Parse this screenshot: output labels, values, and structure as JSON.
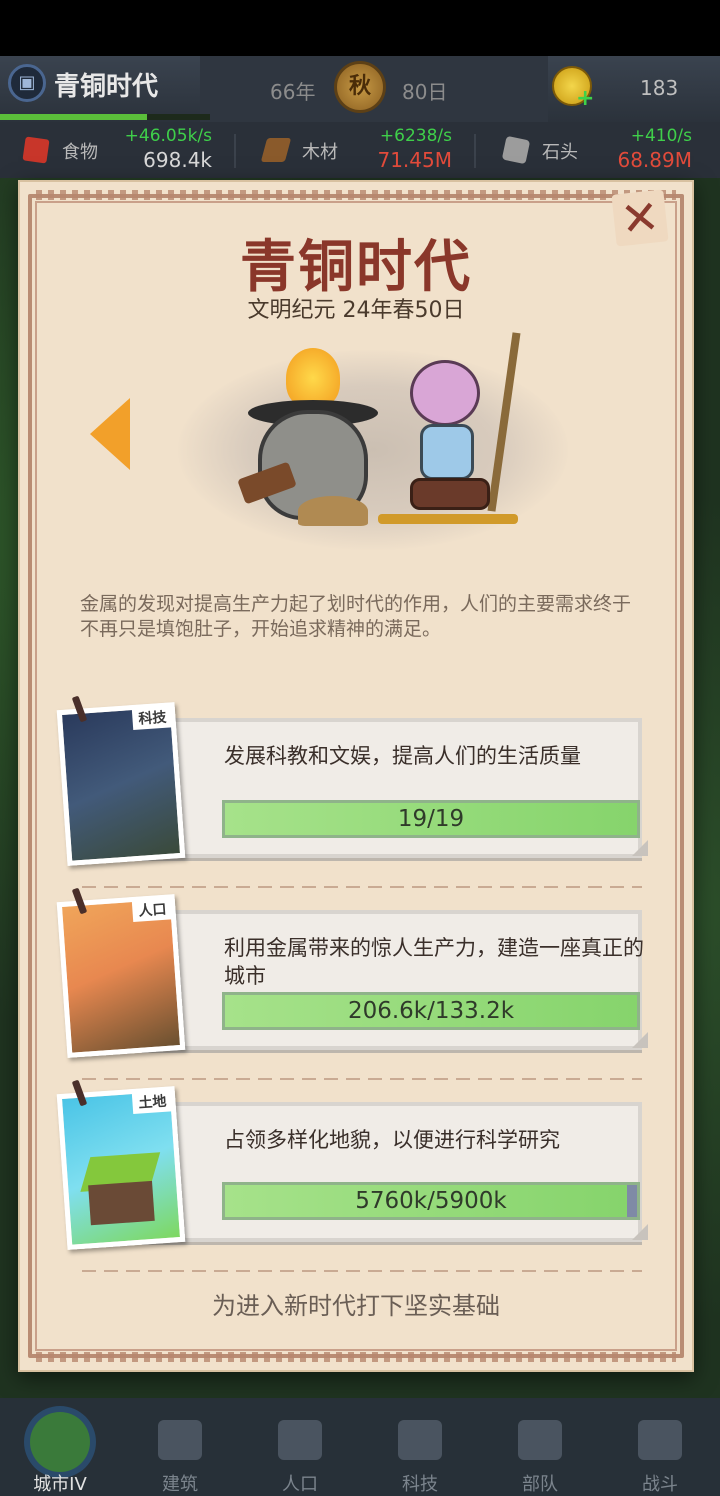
{
  "topbar": {
    "era_title": "青铜时代",
    "year": "66年",
    "season": "秋",
    "day": "80日",
    "coins": "183"
  },
  "resources": [
    {
      "name": "食物",
      "rate": "+46.05k/s",
      "amount": "698.4k"
    },
    {
      "name": "木材",
      "rate": "+6238/s",
      "amount": "71.45M"
    },
    {
      "name": "石头",
      "rate": "+410/s",
      "amount": "68.89M"
    }
  ],
  "dialog": {
    "title": "青铜时代",
    "date": "文明纪元 24年春50日",
    "description": "金属的发现对提高生产力起了划时代的作用，人们的主要需求终于不再只是填饱肚子，开始追求精神的满足。",
    "goals": [
      {
        "tag": "科技",
        "text": "发展科教和文娱，提高人们的生活质量",
        "progress": "19/19",
        "fraction": 1.0
      },
      {
        "tag": "人口",
        "text": "利用金属带来的惊人生产力，建造一座真正的城市",
        "progress": "206.6k/133.2k",
        "fraction": 1.0
      },
      {
        "tag": "土地",
        "text": "占领多样化地貌，以便进行科学研究",
        "progress": "5760k/5900k",
        "fraction": 0.976
      }
    ],
    "footer": "为进入新时代打下坚实基础"
  },
  "nav": [
    {
      "label": "城市IV"
    },
    {
      "label": "建筑"
    },
    {
      "label": "人口"
    },
    {
      "label": "科技"
    },
    {
      "label": "部队"
    },
    {
      "label": "战斗"
    }
  ],
  "colors": {
    "accent_title": "#8a372a",
    "progress_green": "#86d46c",
    "rate_green": "#3fcf4a",
    "warn_red": "#e24b3b"
  }
}
